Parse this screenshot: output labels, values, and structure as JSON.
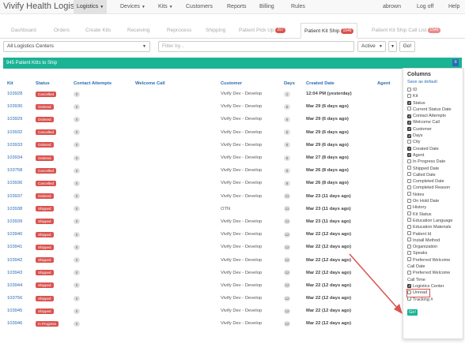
{
  "brand": "Vivify Health Logistics",
  "nav": {
    "items": [
      "Logistics",
      "Devices",
      "Kits",
      "Customers",
      "Reports",
      "Billing",
      "Rules"
    ],
    "user": "abrown",
    "logoff": "Log off",
    "help": "Help"
  },
  "tabs": [
    {
      "label": "Dashboard"
    },
    {
      "label": "Orders"
    },
    {
      "label": "Create Kits"
    },
    {
      "label": "Receiving"
    },
    {
      "label": "Reprocess"
    },
    {
      "label": "Shipping"
    },
    {
      "label": "Patient Pick Up",
      "badge": "267"
    },
    {
      "label": "Patient Kit Ship",
      "badge": "1546"
    },
    {
      "label": "Patient Kit Ship Call List",
      "badge": "1546"
    }
  ],
  "filter": {
    "center": "All Logistics Centers",
    "placeholder": "Filter by...",
    "status": "Active",
    "go": "Go!"
  },
  "panel": {
    "title": "945 Patient Kitts to Ship"
  },
  "table": {
    "headers": [
      "Kit",
      "Status",
      "Contact Attempts",
      "Welcome Call",
      "Customer",
      "Days",
      "Created Date",
      "Agent"
    ],
    "rows": [
      {
        "kit": "103928",
        "status": "Cancelled",
        "attempts": "0",
        "welcome": "",
        "customer": "Vivify Dev - Develop",
        "days": "1",
        "date": "12:04 PM (yesterday)"
      },
      {
        "kit": "103930",
        "status": "Ordered",
        "attempts": "0",
        "welcome": "",
        "customer": "Vivify Dev - Develop",
        "days": "5",
        "date": "Mar 29 (6 days ago)"
      },
      {
        "kit": "103929",
        "status": "Ordered",
        "attempts": "0",
        "welcome": "",
        "customer": "Vivify Dev - Develop",
        "days": "6",
        "date": "Mar 29 (6 days ago)"
      },
      {
        "kit": "103932",
        "status": "Cancelled",
        "attempts": "0",
        "welcome": "",
        "customer": "Vivify Dev - Develop",
        "days": "6",
        "date": "Mar 29 (6 days ago)"
      },
      {
        "kit": "103933",
        "status": "Ordered",
        "attempts": "0",
        "welcome": "",
        "customer": "Vivify Dev - Develop",
        "days": "6",
        "date": "Mar 29 (6 days ago)"
      },
      {
        "kit": "103934",
        "status": "Ordered",
        "attempts": "0",
        "welcome": "",
        "customer": "Vivify Dev - Develop",
        "days": "8",
        "date": "Mar 27 (8 days ago)"
      },
      {
        "kit": "103758",
        "status": "Cancelled",
        "attempts": "0",
        "welcome": "",
        "customer": "Vivify Dev - Develop",
        "days": "8",
        "date": "Mar 26 (8 days ago)"
      },
      {
        "kit": "103936",
        "status": "Cancelled",
        "attempts": "0",
        "welcome": "",
        "customer": "Vivify Dev - Develop",
        "days": "8",
        "date": "Mar 26 (8 days ago)"
      },
      {
        "kit": "103937",
        "status": "Ordered",
        "attempts": "0",
        "welcome": "",
        "customer": "Vivify Dev - Develop",
        "days": "11",
        "date": "Mar 23 (11 days ago)"
      },
      {
        "kit": "103938",
        "status": "Shipped",
        "attempts": "0",
        "welcome": "",
        "customer": "OTN",
        "days": "11",
        "date": "Mar 23 (11 days ago)"
      },
      {
        "kit": "103939",
        "status": "Shipped",
        "attempts": "0",
        "welcome": "",
        "customer": "Vivify Dev - Develop",
        "days": "11",
        "date": "Mar 23 (11 days ago)"
      },
      {
        "kit": "103940",
        "status": "Shipped",
        "attempts": "0",
        "welcome": "",
        "customer": "Vivify Dev - Develop",
        "days": "12",
        "date": "Mar 22 (12 days ago)"
      },
      {
        "kit": "103941",
        "status": "Shipped",
        "attempts": "0",
        "welcome": "",
        "customer": "Vivify Dev - Develop",
        "days": "12",
        "date": "Mar 22 (12 days ago)"
      },
      {
        "kit": "103942",
        "status": "Shipped",
        "attempts": "0",
        "welcome": "",
        "customer": "Vivify Dev - Develop",
        "days": "12",
        "date": "Mar 22 (12 days ago)"
      },
      {
        "kit": "103943",
        "status": "Shipped",
        "attempts": "0",
        "welcome": "",
        "customer": "Vivify Dev - Develop",
        "days": "12",
        "date": "Mar 22 (12 days ago)"
      },
      {
        "kit": "103944",
        "status": "Shipped",
        "attempts": "0",
        "welcome": "",
        "customer": "Vivify Dev - Develop",
        "days": "12",
        "date": "Mar 22 (12 days ago)"
      },
      {
        "kit": "103756",
        "status": "Shipped",
        "attempts": "0",
        "welcome": "",
        "customer": "Vivify Dev - Develop",
        "days": "12",
        "date": "Mar 22 (12 days ago)"
      },
      {
        "kit": "103945",
        "status": "Shipped",
        "attempts": "0",
        "welcome": "",
        "customer": "Vivify Dev - Develop",
        "days": "12",
        "date": "Mar 22 (12 days ago)"
      },
      {
        "kit": "103946",
        "status": "In Progress",
        "attempts": "0",
        "welcome": "",
        "customer": "Vivify Dev - Develop",
        "days": "12",
        "date": "Mar 22 (12 days ago)"
      }
    ]
  },
  "status_colors": {
    "Cancelled": "#d9534f",
    "Ordered": "#d9534f",
    "Shipped": "#d9534f",
    "In Progress": "#d9534f"
  },
  "columns_menu": {
    "title": "Columns",
    "save": "Save as default",
    "go": "Go!",
    "items": [
      {
        "label": "ID",
        "checked": false
      },
      {
        "label": "Kit",
        "checked": false
      },
      {
        "label": "Status",
        "checked": true
      },
      {
        "label": "Current Status Date",
        "checked": false
      },
      {
        "label": "Contact Attempts",
        "checked": true
      },
      {
        "label": "Welcome Call",
        "checked": true
      },
      {
        "label": "Customer",
        "checked": true
      },
      {
        "label": "Days",
        "checked": true
      },
      {
        "label": "City",
        "checked": false
      },
      {
        "label": "Created Date",
        "checked": true
      },
      {
        "label": "Agent",
        "checked": true
      },
      {
        "label": "In Progress Date",
        "checked": false
      },
      {
        "label": "Shipped Date",
        "checked": false
      },
      {
        "label": "Called Date",
        "checked": false
      },
      {
        "label": "Completed Date",
        "checked": false
      },
      {
        "label": "Completed Reason",
        "checked": false
      },
      {
        "label": "Notes",
        "checked": false
      },
      {
        "label": "On Hold Date",
        "checked": false
      },
      {
        "label": "History",
        "checked": false
      },
      {
        "label": "Kit Status",
        "checked": false
      },
      {
        "label": "Education Language",
        "checked": false
      },
      {
        "label": "Education Materials",
        "checked": false
      },
      {
        "label": "Patient Id",
        "checked": false
      },
      {
        "label": "Install Method",
        "checked": false
      },
      {
        "label": "Organization",
        "checked": false
      },
      {
        "label": "Speaks",
        "checked": false
      },
      {
        "label": "Preferred Welcome Call Date",
        "checked": false
      },
      {
        "label": "Preferred Welcome Call Time",
        "checked": false
      },
      {
        "label": "Logistics Center",
        "checked": true
      },
      {
        "label": "Unread",
        "checked": false,
        "highlighted": true
      },
      {
        "label": "Tracking #",
        "checked": false
      }
    ]
  },
  "accent_color": "#1ab394",
  "link_color": "#2a6bb5",
  "annotation_color": "#d9534f"
}
